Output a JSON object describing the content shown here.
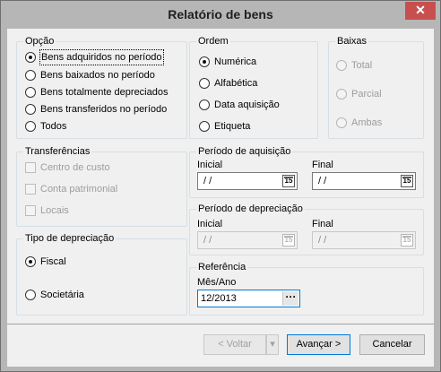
{
  "window": {
    "title": "Relatório de bens",
    "close_glyph": "✕"
  },
  "opcao": {
    "label": "Opção",
    "items": [
      {
        "label": "Bens adquiridos no período",
        "checked": true
      },
      {
        "label": "Bens baixados no período",
        "checked": false
      },
      {
        "label": "Bens totalmente depreciados",
        "checked": false
      },
      {
        "label": "Bens transferidos no período",
        "checked": false
      },
      {
        "label": "Todos",
        "checked": false
      }
    ]
  },
  "ordem": {
    "label": "Ordem",
    "items": [
      {
        "label": "Numérica",
        "checked": true
      },
      {
        "label": "Alfabética",
        "checked": false
      },
      {
        "label": "Data aquisição",
        "checked": false
      },
      {
        "label": "Etiqueta",
        "checked": false
      }
    ]
  },
  "baixas": {
    "label": "Baixas",
    "items": [
      {
        "label": "Total"
      },
      {
        "label": "Parcial"
      },
      {
        "label": "Ambas"
      }
    ]
  },
  "transferencias": {
    "label": "Transferências",
    "items": [
      {
        "label": "Centro de custo"
      },
      {
        "label": "Conta patrimonial"
      },
      {
        "label": "Locais"
      }
    ]
  },
  "periodo_aquisicao": {
    "label": "Período de aquisição",
    "inicial_label": "Inicial",
    "inicial_value": " /  /",
    "final_label": "Final",
    "final_value": " /  /",
    "cal_glyph": "15"
  },
  "tipo_depreciacao": {
    "label": "Tipo de depreciação",
    "items": [
      {
        "label": "Fiscal",
        "checked": true
      },
      {
        "label": "Societária",
        "checked": false
      }
    ]
  },
  "periodo_depreciacao": {
    "label": "Período de depreciação",
    "inicial_label": "Inicial",
    "inicial_value": " /  /",
    "final_label": "Final",
    "final_value": " /  /",
    "cal_glyph": "15"
  },
  "referencia": {
    "label": "Referência",
    "field_label": "Mês/Ano",
    "value": "12/2013",
    "button_glyph": "···"
  },
  "footer": {
    "voltar_label": "< Voltar",
    "dropdown_glyph": "▾",
    "avancar_label": "Avançar >",
    "cancelar_label": "Cancelar"
  }
}
